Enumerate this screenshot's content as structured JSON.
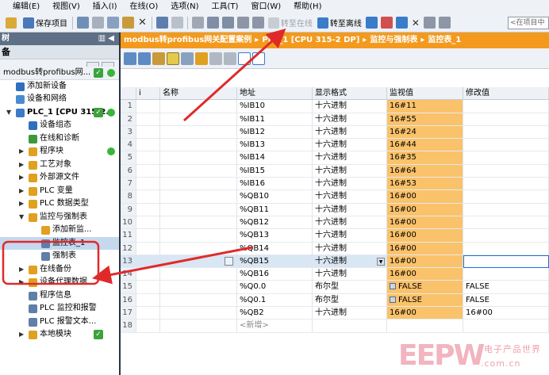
{
  "menu": [
    "编辑(E)",
    "视图(V)",
    "插入(I)",
    "在线(O)",
    "选项(N)",
    "工具(T)",
    "窗口(W)",
    "帮助(H)"
  ],
  "toolbar": {
    "save_project": "保存项目",
    "go_online": "转至在线",
    "go_offline": "转至离线",
    "search_placeholder": "<在项目中"
  },
  "left_panel": {
    "title": "树",
    "collapse": "◀",
    "subtitle": "备",
    "tree": [
      {
        "label": "modbus转profibus网...",
        "indent": 4,
        "arrow": "",
        "icon": "",
        "check": true,
        "dot": true,
        "header": true
      },
      {
        "label": "添加新设备",
        "indent": 20,
        "arrow": "",
        "icon": "#2f6fc0"
      },
      {
        "label": "设备和网络",
        "indent": 20,
        "arrow": "",
        "icon": "#4a8bd0"
      },
      {
        "label": "PLC_1 [CPU 315-2...",
        "indent": 20,
        "arrow": "▼",
        "icon": "#3a7cc8",
        "check": true,
        "dot": true,
        "bold": true
      },
      {
        "label": "设备组态",
        "indent": 36,
        "arrow": "",
        "icon": "#2f6fc0"
      },
      {
        "label": "在线和诊断",
        "indent": 36,
        "arrow": "",
        "icon": "#3b9a3b"
      },
      {
        "label": "程序块",
        "indent": 36,
        "arrow": "▶",
        "icon": "#e0a020",
        "dot": true
      },
      {
        "label": "工艺对象",
        "indent": 36,
        "arrow": "▶",
        "icon": "#e0a020"
      },
      {
        "label": "外部源文件",
        "indent": 36,
        "arrow": "▶",
        "icon": "#e0a020"
      },
      {
        "label": "PLC 变量",
        "indent": 36,
        "arrow": "▶",
        "icon": "#e0a020"
      },
      {
        "label": "PLC 数据类型",
        "indent": 36,
        "arrow": "▶",
        "icon": "#e0a020"
      },
      {
        "label": "监控与强制表",
        "indent": 36,
        "arrow": "▼",
        "icon": "#e0a020"
      },
      {
        "label": "添加新监...",
        "indent": 52,
        "arrow": "",
        "icon": "#e0a020"
      },
      {
        "label": "监控表_1",
        "indent": 52,
        "arrow": "",
        "icon": "#5f7fa8",
        "selected": true
      },
      {
        "label": "强制表",
        "indent": 52,
        "arrow": "",
        "icon": "#5f7fa8"
      },
      {
        "label": "在线备份",
        "indent": 36,
        "arrow": "▶",
        "icon": "#e0a020"
      },
      {
        "label": "设备代理数据",
        "indent": 36,
        "arrow": "▶",
        "icon": "#e0a020"
      },
      {
        "label": "程序信息",
        "indent": 36,
        "arrow": "",
        "icon": "#5f7fa8"
      },
      {
        "label": "PLC 监控和报警",
        "indent": 36,
        "arrow": "",
        "icon": "#5f7fa8"
      },
      {
        "label": "PLC 报警文本...",
        "indent": 36,
        "arrow": "",
        "icon": "#5f7fa8"
      },
      {
        "label": "本地模块",
        "indent": 36,
        "arrow": "▶",
        "icon": "#e0a020",
        "check": true
      }
    ]
  },
  "breadcrumb": [
    "modbus转profibus网关配置案例",
    "PLC_1 [CPU 315-2 DP]",
    "监控与强制表",
    "监控表_1"
  ],
  "table": {
    "columns": [
      "",
      "i",
      "名称",
      "地址",
      "显示格式",
      "监视值",
      "修改值"
    ],
    "rows": [
      {
        "n": "1",
        "addr": "%IB10",
        "fmt": "十六进制",
        "mon": "16#11",
        "mod": ""
      },
      {
        "n": "2",
        "addr": "%IB11",
        "fmt": "十六进制",
        "mon": "16#55",
        "mod": ""
      },
      {
        "n": "3",
        "addr": "%IB12",
        "fmt": "十六进制",
        "mon": "16#24",
        "mod": ""
      },
      {
        "n": "4",
        "addr": "%IB13",
        "fmt": "十六进制",
        "mon": "16#44",
        "mod": ""
      },
      {
        "n": "5",
        "addr": "%IB14",
        "fmt": "十六进制",
        "mon": "16#35",
        "mod": ""
      },
      {
        "n": "6",
        "addr": "%IB15",
        "fmt": "十六进制",
        "mon": "16#64",
        "mod": ""
      },
      {
        "n": "7",
        "addr": "%IB16",
        "fmt": "十六进制",
        "mon": "16#53",
        "mod": ""
      },
      {
        "n": "8",
        "addr": "%QB10",
        "fmt": "十六进制",
        "mon": "16#00",
        "mod": ""
      },
      {
        "n": "9",
        "addr": "%QB11",
        "fmt": "十六进制",
        "mon": "16#00",
        "mod": ""
      },
      {
        "n": "10",
        "addr": "%QB12",
        "fmt": "十六进制",
        "mon": "16#00",
        "mod": ""
      },
      {
        "n": "11",
        "addr": "%QB13",
        "fmt": "十六进制",
        "mon": "16#00",
        "mod": ""
      },
      {
        "n": "12",
        "addr": "%QB14",
        "fmt": "十六进制",
        "mon": "16#00",
        "mod": ""
      },
      {
        "n": "13",
        "addr": "%QB15",
        "fmt": "十六进制",
        "mon": "16#00",
        "mod": "",
        "selected": true
      },
      {
        "n": "14",
        "addr": "%QB16",
        "fmt": "十六进制",
        "mon": "16#00",
        "mod": ""
      },
      {
        "n": "15",
        "addr": "%Q0.0",
        "fmt": "布尔型",
        "mon": "FALSE",
        "mod": "FALSE",
        "bool": true
      },
      {
        "n": "16",
        "addr": "%Q0.1",
        "fmt": "布尔型",
        "mon": "FALSE",
        "mod": "FALSE",
        "bool": true
      },
      {
        "n": "17",
        "addr": "%QB2",
        "fmt": "十六进制",
        "mon": "16#00",
        "mod": "16#00"
      },
      {
        "n": "18",
        "addr": "<新增>",
        "fmt": "",
        "mon": "",
        "mod": "",
        "new": true
      }
    ]
  },
  "watermark": {
    "logo": "EEPW",
    "cn": "电子产品世界",
    "url": ".com.cn"
  }
}
